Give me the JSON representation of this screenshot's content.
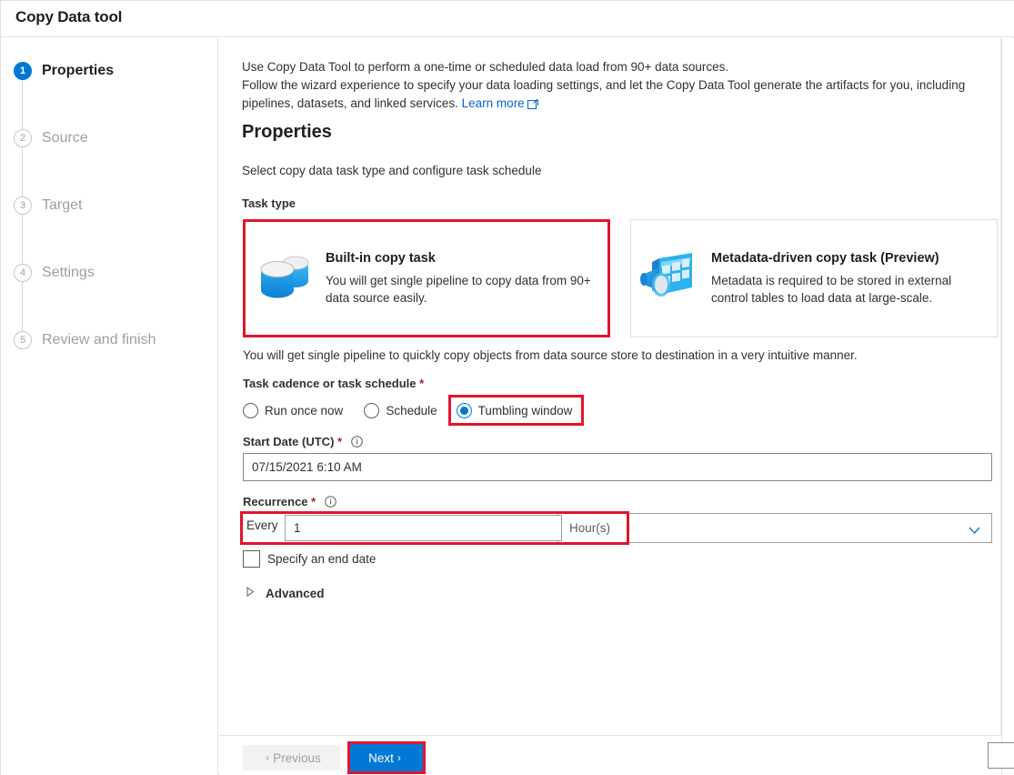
{
  "window": {
    "title": "Copy Data tool"
  },
  "sidebar": {
    "steps": [
      {
        "num": "1",
        "label": "Properties",
        "state": "active"
      },
      {
        "num": "2",
        "label": "Source",
        "state": "inactive"
      },
      {
        "num": "3",
        "label": "Target",
        "state": "inactive"
      },
      {
        "num": "4",
        "label": "Settings",
        "state": "inactive"
      },
      {
        "num": "5",
        "label": "Review and finish",
        "state": "inactive"
      }
    ]
  },
  "intro": {
    "line1": "Use Copy Data Tool to perform a one-time or scheduled data load from 90+ data sources.",
    "line2": "Follow the wizard experience to specify your data loading settings, and let the Copy Data Tool generate the artifacts for you, including",
    "line3": "pipelines, datasets, and linked services.",
    "learn_more": "Learn more",
    "learn_more_icon": "external-link-icon"
  },
  "section": {
    "title": "Properties",
    "subtitle": "Select copy data task type and configure task schedule"
  },
  "task_type": {
    "label": "Task type",
    "cards": [
      {
        "title": "Built-in copy task",
        "desc": "You will get single pipeline to copy data from 90+ data source easily.",
        "icon": "database-cylinders-icon",
        "selected": true
      },
      {
        "title": "Metadata-driven copy task (Preview)",
        "desc": "Metadata is required to be stored in external control tables to load data at large-scale.",
        "icon": "metadata-table-funnel-icon",
        "selected": false
      }
    ],
    "note": "You will get single pipeline to quickly copy objects from data source store to destination in a very intuitive manner."
  },
  "cadence": {
    "label": "Task cadence or task schedule",
    "required": "*",
    "options": [
      {
        "label": "Run once now",
        "checked": false
      },
      {
        "label": "Schedule",
        "checked": false
      },
      {
        "label": "Tumbling window",
        "checked": true
      }
    ]
  },
  "start_date": {
    "label": "Start Date (UTC)",
    "required": "*",
    "info_icon": "info-circle-icon",
    "value": "07/15/2021 6:10 AM",
    "placeholder": ""
  },
  "recurrence": {
    "label": "Recurrence",
    "required": "*",
    "info_icon": "info-circle-icon",
    "every_label": "Every",
    "every_value": "1",
    "unit_value": "Hour(s)",
    "unit_chevron_icon": "chevron-down-icon"
  },
  "end_date": {
    "label": "Specify an end date",
    "checked": false
  },
  "advanced": {
    "label": "Advanced",
    "expanded": false,
    "icon": "triangle-right-icon"
  },
  "footer": {
    "previous_label": "Previous",
    "previous_chevron": "‹",
    "next_label": "Next",
    "next_chevron": "›"
  },
  "colors": {
    "accent": "#0078d4",
    "highlight": "#e3142d",
    "link": "#0066cc",
    "required": "#a4262c",
    "muted": "#a19f9d"
  }
}
